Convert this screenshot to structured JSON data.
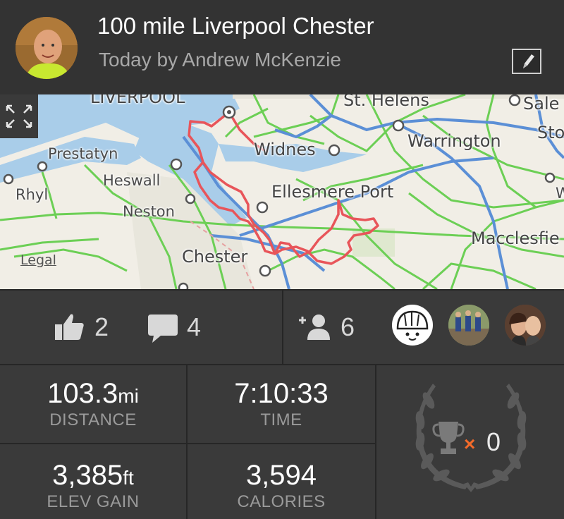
{
  "activity": {
    "title": "100 mile Liverpool Chester",
    "subtitle": "Today by Andrew McKenzie"
  },
  "map": {
    "labels": {
      "liverpool": "LIVERPOOL",
      "st_helens": "St. Helens",
      "sale": "Sale",
      "stockport": "Sto",
      "prestatyn": "Prestatyn",
      "widnes": "Widnes",
      "warrington": "Warrington",
      "heswall": "Heswall",
      "rhyl": "Rhyl",
      "ellesmere_port": "Ellesmere Port",
      "neston": "Neston",
      "macclesfield": "Macclesfie",
      "chester": "Chester",
      "w": "W"
    },
    "legal": "Legal"
  },
  "social": {
    "kudos_count": "2",
    "comments_count": "4",
    "athletes_count": "6"
  },
  "stats": {
    "distance": {
      "value": "103.3",
      "unit": "mi",
      "label": "DISTANCE"
    },
    "time": {
      "value": "7:10:33",
      "label": "TIME"
    },
    "elevation": {
      "value": "3,385",
      "unit": "ft",
      "label": "ELEV GAIN"
    },
    "calories": {
      "value": "3,594",
      "label": "CALORIES"
    },
    "achievements": {
      "multiplier": "×",
      "count": "0"
    }
  },
  "colors": {
    "route": "#e8555a",
    "motorway": "#5b8fd6",
    "road": "#6ccf55",
    "water": "#a9cde9",
    "accent": "#f26a2a"
  }
}
